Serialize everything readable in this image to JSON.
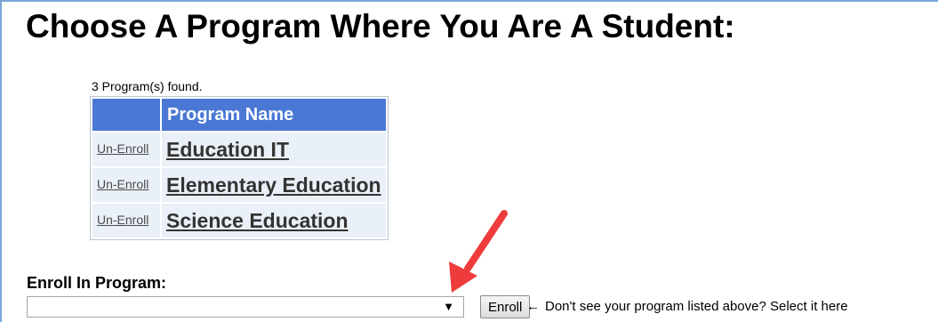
{
  "page": {
    "title": "Choose A Program Where You Are A Student:",
    "count_text": "3 Program(s) found."
  },
  "programs_table": {
    "columns": [
      "",
      "Program Name"
    ],
    "rows": [
      {
        "action": "Un-Enroll",
        "program": "Education IT"
      },
      {
        "action": "Un-Enroll",
        "program": "Elementary Education"
      },
      {
        "action": "Un-Enroll",
        "program": "Science Education"
      }
    ]
  },
  "enroll": {
    "heading": "Enroll In Program:",
    "select_value": "",
    "button_label": "Enroll",
    "hint_arrow": "←",
    "hint_text": "Don't see your program listed above? Select it here",
    "dropdown_glyph": "▼"
  },
  "colors": {
    "header_bg": "#4a78d4",
    "row_bg": "#eaf0f8",
    "annotation_arrow": "#ee3b3b",
    "frame_border": "#7aa7d6"
  },
  "icons": {
    "dropdown": "chevron-down-icon",
    "hint_arrow": "left-arrow-icon",
    "annotation": "red-arrow-annotation"
  }
}
